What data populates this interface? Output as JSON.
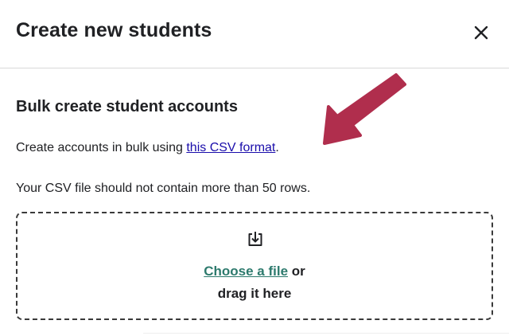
{
  "dialog": {
    "title": "Create new students",
    "close_icon": "close-icon"
  },
  "bulk": {
    "title": "Bulk create student accounts",
    "description_prefix": "Create accounts in bulk using ",
    "csv_link_label": "this CSV format",
    "description_suffix": ".",
    "rows_note": "Your CSV file should not contain more than 50 rows."
  },
  "dropzone": {
    "icon": "upload-icon",
    "choose_label": "Choose a file",
    "or_label": " or",
    "drag_label": "drag it here"
  },
  "annotation": {
    "icon": "arrow-icon",
    "color": "#b02e4d"
  },
  "colors": {
    "link": "#1a0dab",
    "choose_link": "#2d7a6d",
    "annotation_arrow": "#b02e4d"
  }
}
